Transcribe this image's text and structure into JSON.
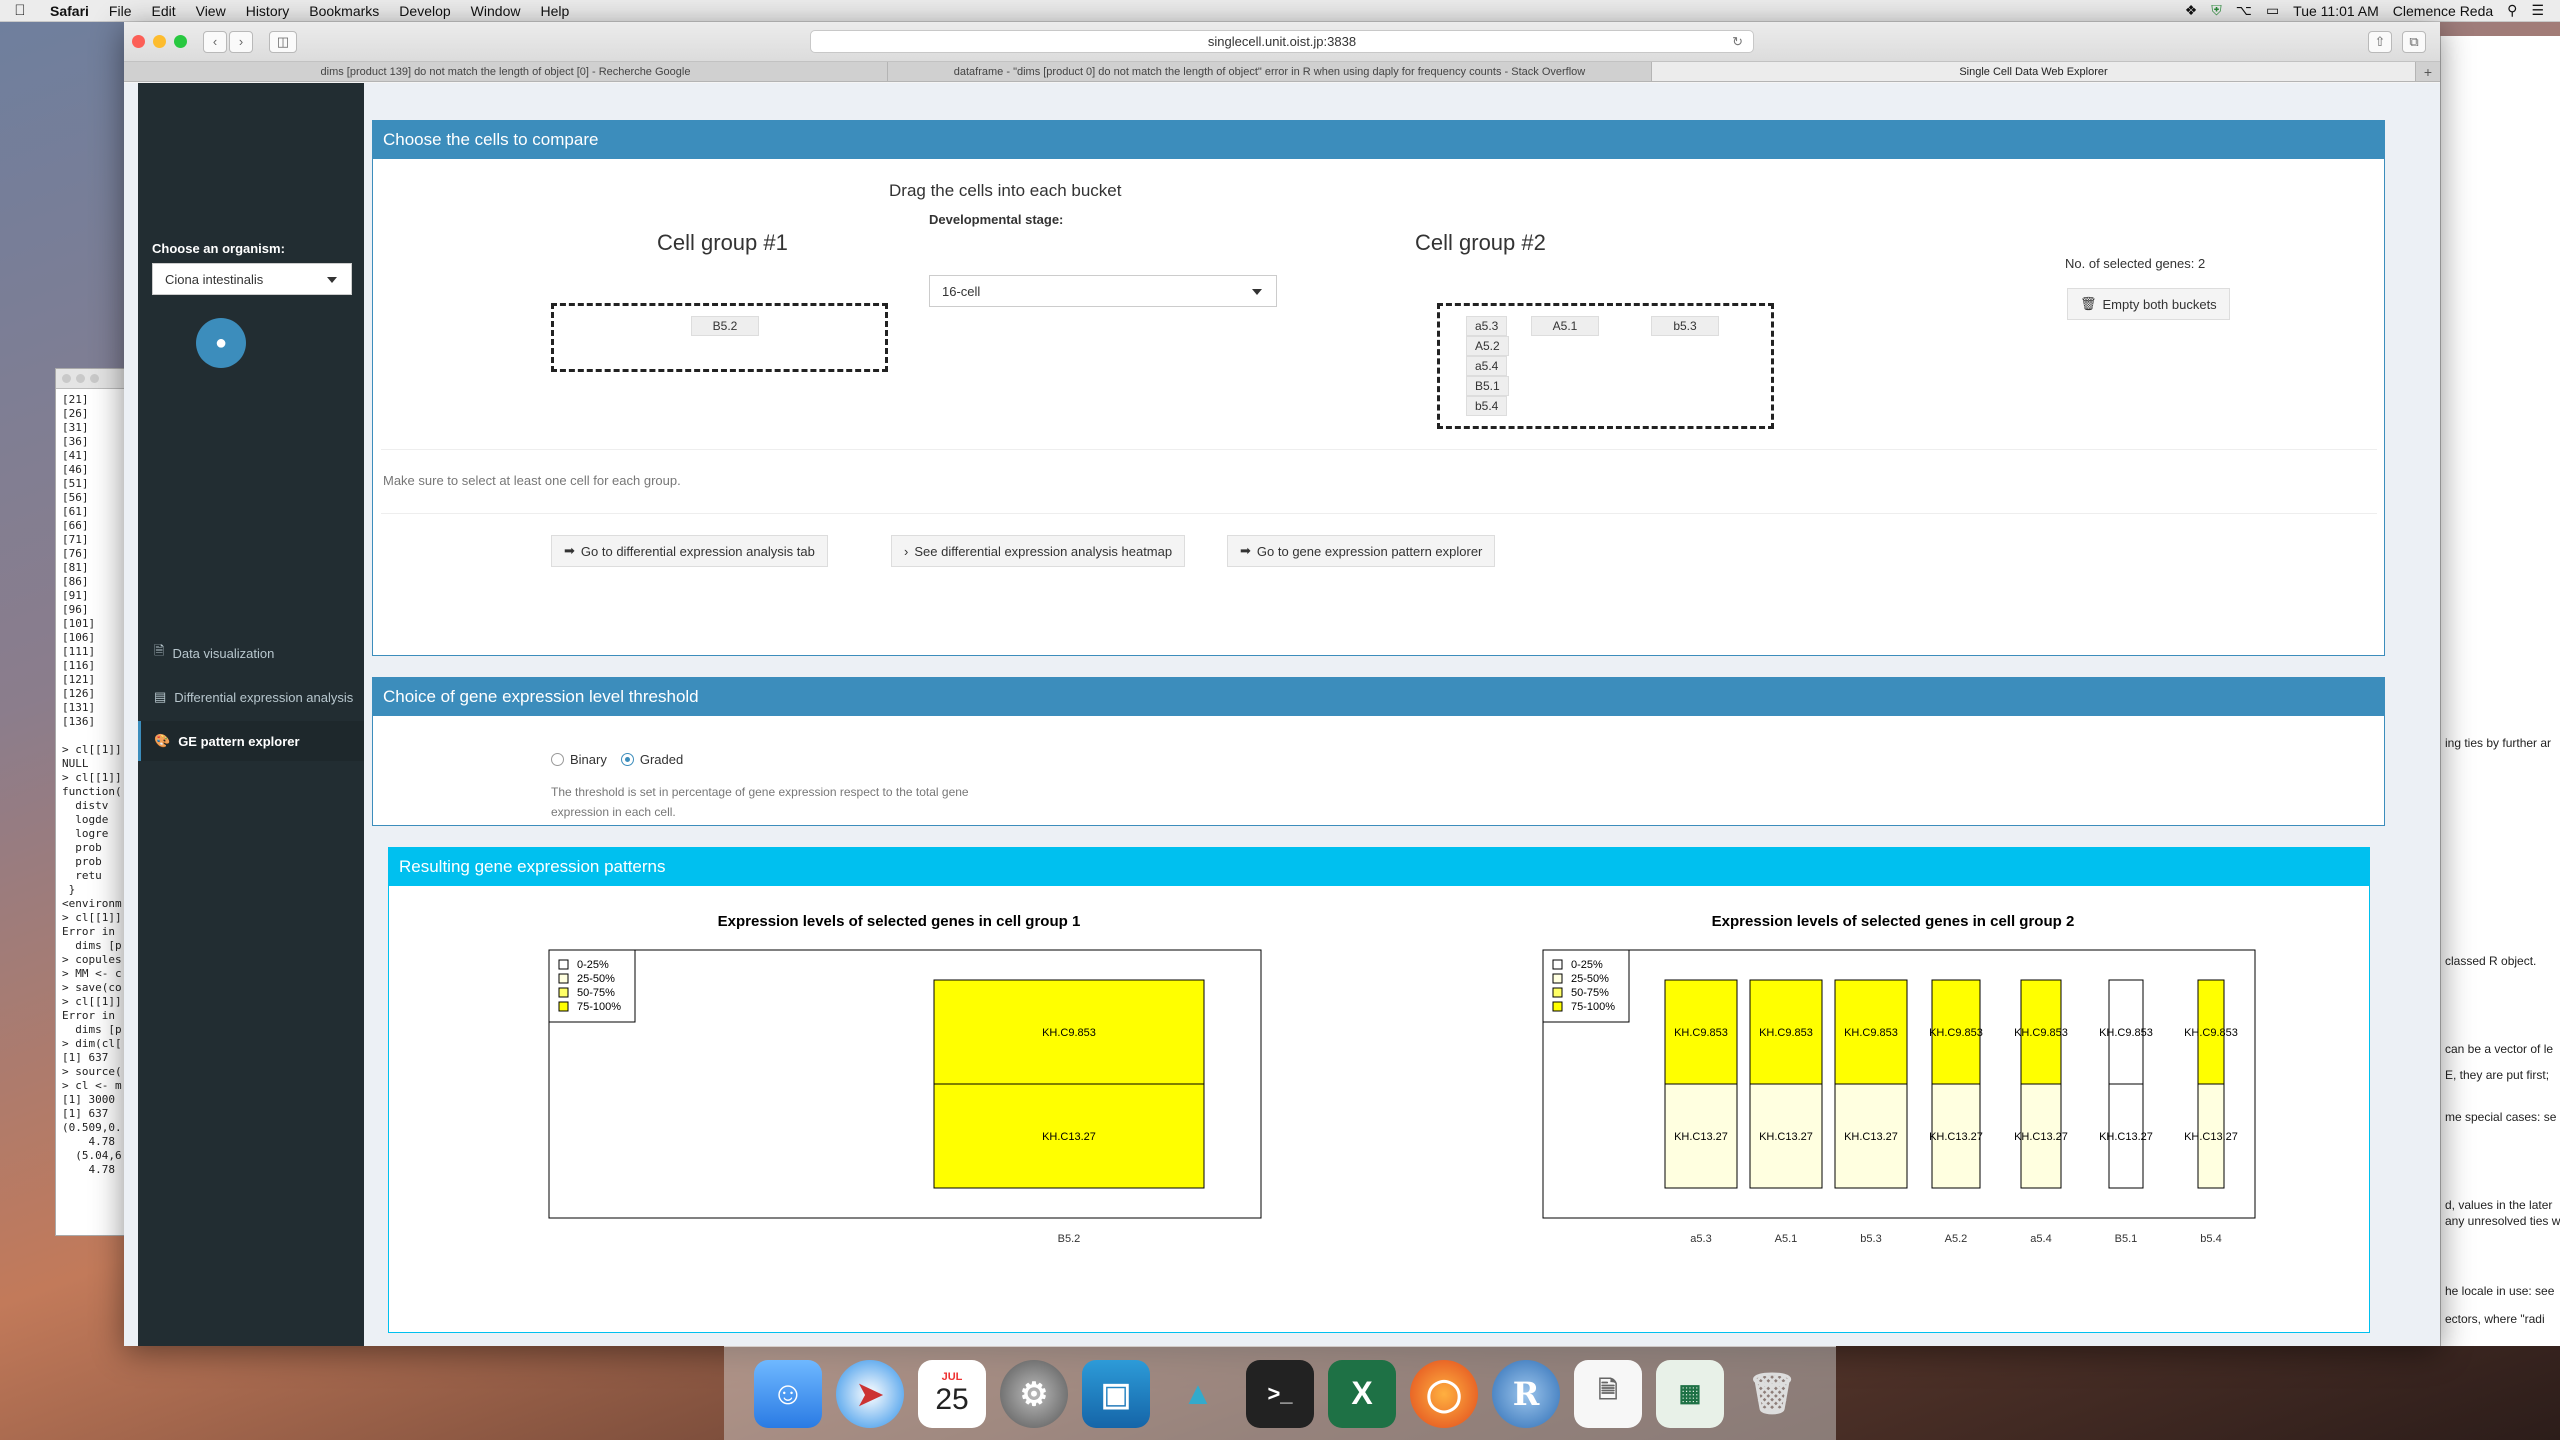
{
  "menubar": {
    "apple": "",
    "items": [
      "Safari",
      "File",
      "Edit",
      "View",
      "History",
      "Bookmarks",
      "Develop",
      "Window",
      "Help"
    ],
    "clock": "Tue 11:01 AM",
    "user": "Clemence Reda"
  },
  "browser": {
    "url": "singlecell.unit.oist.jp:3838",
    "tabs": [
      "dims [product 139] do not match the length of object [0] - Recherche Google",
      "dataframe - \"dims [product 0] do not match the length of object\" error in R when using daply for frequency counts - Stack Overflow",
      "Single Cell Data Web Explorer"
    ]
  },
  "sidebar": {
    "organism_label": "Choose an organism:",
    "organism_value": "Ciona intestinalis",
    "nav": [
      {
        "label": "Data visualization",
        "icon": "document-icon"
      },
      {
        "label": "Differential expression analysis",
        "icon": "bar-chart-icon"
      },
      {
        "label": "GE pattern explorer",
        "icon": "palette-icon"
      }
    ]
  },
  "compare": {
    "title": "Choose the cells to compare",
    "instruction": "Drag the cells into each bucket",
    "stage_label": "Developmental stage:",
    "stage_value": "16-cell",
    "group1_title": "Cell group #1",
    "group2_title": "Cell group #2",
    "group1_cells": [
      "B5.2"
    ],
    "group2_cells": [
      "a5.3",
      "A5.1",
      "b5.3",
      "A5.2",
      "a5.4",
      "B5.1",
      "b5.4"
    ],
    "selected_genes": "No. of selected genes: 2",
    "empty_button": "Empty both buckets",
    "hint": "Make sure to select at least one cell for each group.",
    "btn_diff_tab": "Go to differential expression analysis tab",
    "btn_heatmap": "See differential expression analysis heatmap",
    "btn_pattern": "Go to gene expression pattern explorer"
  },
  "threshold": {
    "title": "Choice of gene expression level threshold",
    "options": [
      "Binary",
      "Graded"
    ],
    "selected": "Graded",
    "note_line1": "The threshold is set in percentage of gene expression respect to the total gene",
    "note_line2": "expression in each cell."
  },
  "results": {
    "title": "Resulting gene expression patterns"
  },
  "chart_data": [
    {
      "type": "bar",
      "title": "Expression levels of selected genes in cell group 1",
      "categories": [
        "B5.2"
      ],
      "legend": {
        "position": "top-left",
        "entries": [
          "0-25%",
          "25-50%",
          "50-75%",
          "75-100%"
        ],
        "colors": [
          "#ffffff",
          "#ffffe0",
          "#ffff66",
          "#ffff00"
        ]
      },
      "genes": [
        "KH.C9.853",
        "KH.C13.27"
      ],
      "cells": [
        {
          "name": "B5.2",
          "levels": {
            "KH.C9.853": "75-100%",
            "KH.C13.27": "75-100%"
          }
        }
      ]
    },
    {
      "type": "bar",
      "title": "Expression levels of selected genes in cell group 2",
      "categories": [
        "a5.3",
        "A5.1",
        "b5.3",
        "A5.2",
        "a5.4",
        "B5.1",
        "b5.4"
      ],
      "legend": {
        "position": "top-left",
        "entries": [
          "0-25%",
          "25-50%",
          "50-75%",
          "75-100%"
        ],
        "colors": [
          "#ffffff",
          "#ffffe0",
          "#ffff66",
          "#ffff00"
        ]
      },
      "genes": [
        "KH.C9.853",
        "KH.C13.27"
      ],
      "cells": [
        {
          "name": "a5.3",
          "levels": {
            "KH.C9.853": "75-100%",
            "KH.C13.27": "25-50%"
          }
        },
        {
          "name": "A5.1",
          "levels": {
            "KH.C9.853": "75-100%",
            "KH.C13.27": "25-50%"
          }
        },
        {
          "name": "b5.3",
          "levels": {
            "KH.C9.853": "75-100%",
            "KH.C13.27": "25-50%"
          }
        },
        {
          "name": "A5.2",
          "levels": {
            "KH.C9.853": "75-100%",
            "KH.C13.27": "25-50%"
          }
        },
        {
          "name": "a5.4",
          "levels": {
            "KH.C9.853": "75-100%",
            "KH.C13.27": "25-50%"
          }
        },
        {
          "name": "B5.1",
          "levels": {
            "KH.C9.853": "0-25%",
            "KH.C13.27": "0-25%"
          }
        },
        {
          "name": "b5.4",
          "levels": {
            "KH.C9.853": "75-100%",
            "KH.C13.27": "25-50%"
          }
        }
      ]
    }
  ],
  "colors": {
    "primary": "#3c8dbc",
    "info": "#00c0ef",
    "sidebar": "#222d32"
  },
  "background": {
    "r_console": "[21]\n[26]\n[31]\n[36]\n[41]\n[46]\n[51]\n[56]\n[61]\n[66]\n[71]\n[76]\n[81]\n[86]\n[91]\n[96]\n[101]\n[106]\n[111]\n[116]\n[121]\n[126]\n[131]\n[136]\n\n> cl[[1]]\nNULL\n> cl[[1]]\nfunction(\n  distv\n  logde\n  logre\n  prob\n  prob\n  retu\n }\n<environm\n> cl[[1]]\nError in\n  dims [p\n> copules\n> MM <- c\n> save(co\n> cl[[1]]\nError in\n  dims [p\n> dim(cl[\n[1] 637\n> source(\n> cl <- m\n[1] 3000\n[1] 637\n(0.509,0.\n    4.78\n  (5.04,6\n    4.78",
    "doc_lines": [
      "ing ties by further ar",
      "classed R object.",
      "can be a vector of le",
      "E, they are put first;",
      "me special cases: se",
      "d, values in the later",
      "any unresolved ties w",
      "he locale in use: see",
      "ectors, where \"radi"
    ]
  },
  "dock": {
    "calendar_month": "JUL",
    "calendar_day": "25"
  }
}
